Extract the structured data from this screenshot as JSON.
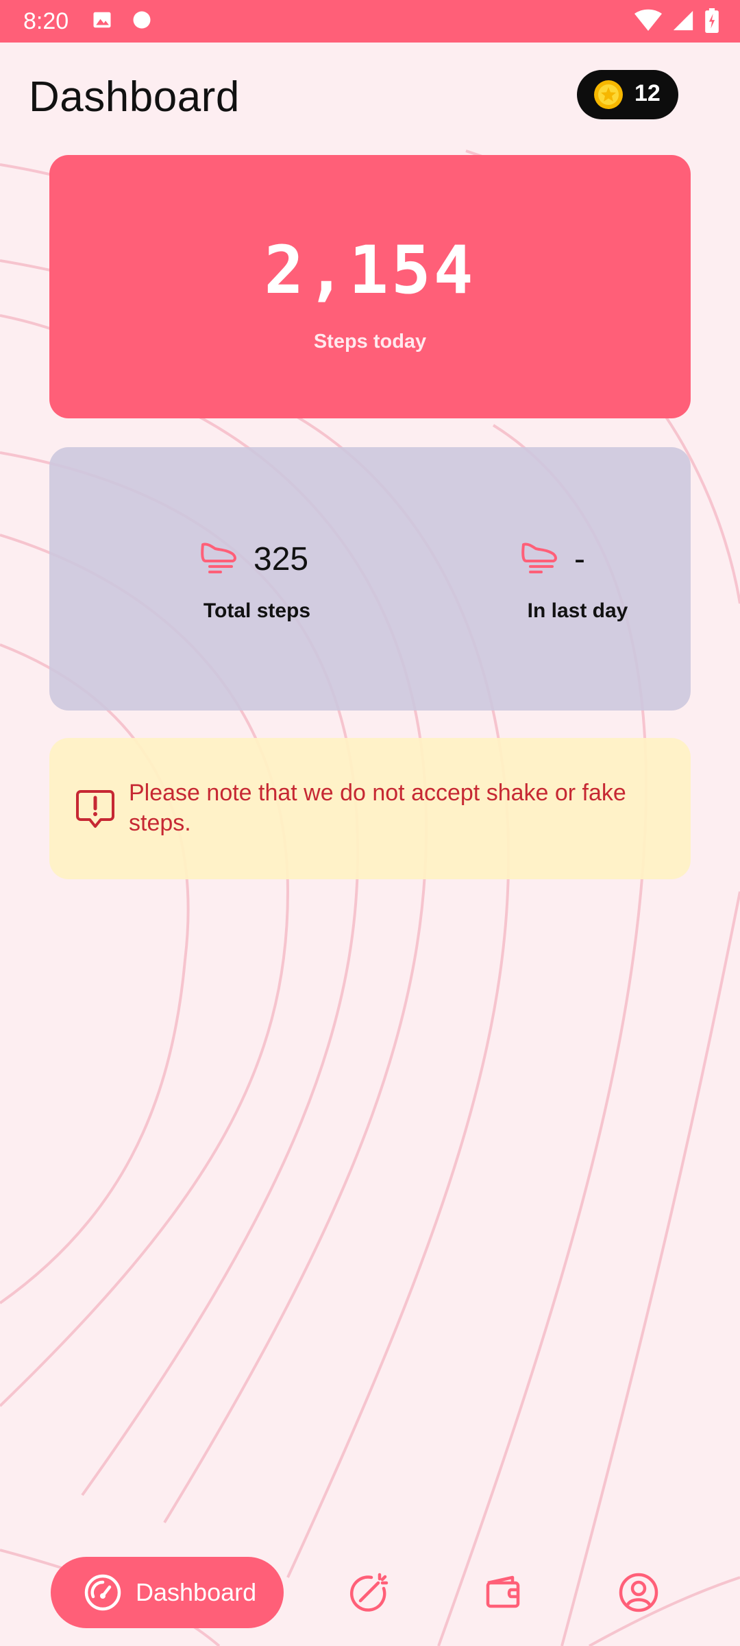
{
  "status_bar": {
    "time": "8:20",
    "icons": [
      "image-icon",
      "circle-notification-icon",
      "wifi-icon",
      "cellular-signal-icon",
      "battery-icon"
    ]
  },
  "header": {
    "title": "Dashboard",
    "coins": "12",
    "coin_icon": "star-coin-icon"
  },
  "steps_card": {
    "value": "2,154",
    "label": "Steps today"
  },
  "stats": {
    "total": {
      "value": "325",
      "label": "Total steps",
      "icon": "shoe-icon"
    },
    "last_day": {
      "value": "-",
      "label": "In last day",
      "icon": "shoe-icon"
    }
  },
  "notice": {
    "icon": "alert-message-icon",
    "text": "Please note that we do not accept shake or fake steps."
  },
  "bottom_nav": {
    "active_label": "Dashboard",
    "items": [
      "speedometer-icon",
      "goal-target-icon",
      "wallet-icon",
      "profile-icon"
    ]
  },
  "colors": {
    "primary": "#ff5f78",
    "background": "#fdeef1",
    "stats_card": "#cdc8de",
    "notice_bg": "#fff2c4",
    "notice_text": "#c62833"
  }
}
